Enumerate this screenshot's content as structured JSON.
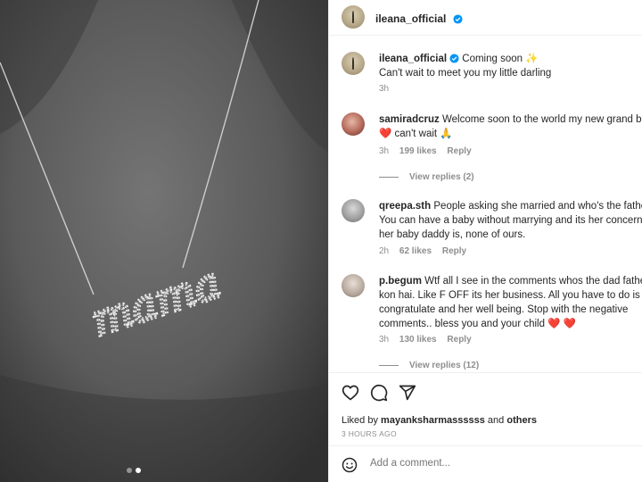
{
  "post": {
    "image": {
      "necklace_text": "mama",
      "carousel_count": 2,
      "carousel_active_index": 1
    },
    "header": {
      "username": "ileana_official",
      "verified": true
    },
    "caption": {
      "username": "ileana_official",
      "line1": "Coming soon",
      "line1_emoji": "✨",
      "line2": "Can't wait to meet you my little darling",
      "time": "3h"
    },
    "comments": [
      {
        "username": "samiradcruz",
        "line1": "Welcome soon to the world my new grand ba",
        "line2_prefix": "❤️",
        "line2": "can't wait",
        "line2_suffix": "🙏",
        "time": "3h",
        "likes": "199 likes",
        "reply": "Reply",
        "view_replies": "View replies (2)"
      },
      {
        "username": "qreepa.sth",
        "line1": "People asking she married and who's the father",
        "line2": "You can have a baby without marrying and its her concern w",
        "line3": "her baby daddy is, none of ours.",
        "time": "2h",
        "likes": "62 likes",
        "reply": "Reply"
      },
      {
        "username": "p.begum",
        "line1": "Wtf all I see in the comments whos the dad father",
        "line2": "kon hai. Like F OFF its her business. All you have to do is",
        "line3": "congratulate and her well being. Stop with the negative",
        "line4": "comments.. bless you and your child",
        "line4_suffix": "❤️ ❤️",
        "time": "3h",
        "likes": "130 likes",
        "reply": "Reply",
        "view_replies": "View replies (12)"
      }
    ],
    "actions": {
      "icons": [
        "heart-icon",
        "comment-icon",
        "share-icon"
      ],
      "liked_by_prefix": "Liked by",
      "liked_by_user": "mayanksharmassssss",
      "liked_by_and": "and",
      "liked_by_others": "others",
      "timestamp": "3 HOURS AGO"
    },
    "add_comment": {
      "placeholder": "Add a comment..."
    }
  },
  "colors": {
    "verified": "#0095f6",
    "heart": "#ed4956",
    "text": "#262626",
    "muted": "#8e8e8e",
    "border": "#efefef"
  }
}
